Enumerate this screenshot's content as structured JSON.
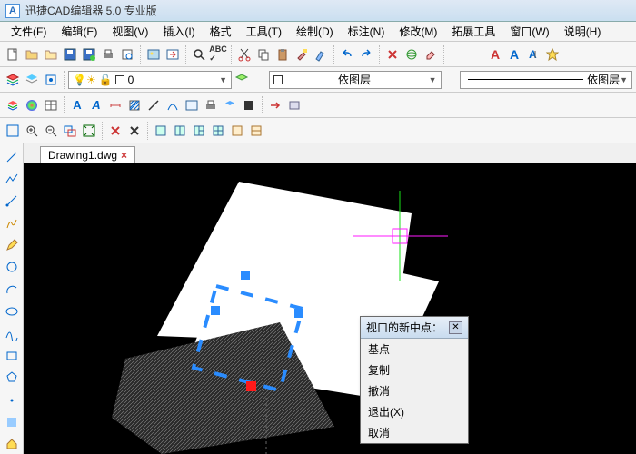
{
  "app": {
    "title": "迅捷CAD编辑器 5.0 专业版",
    "logo_text": "A"
  },
  "menu": {
    "items": [
      "文件(F)",
      "编辑(E)",
      "视图(V)",
      "插入(I)",
      "格式",
      "工具(T)",
      "绘制(D)",
      "标注(N)",
      "修改(M)",
      "拓展工具",
      "窗口(W)",
      "说明(H)"
    ]
  },
  "layer": {
    "current": "0",
    "bylayer1": "依图层",
    "bylayer2": "依图层"
  },
  "tab": {
    "name": "Drawing1.dwg"
  },
  "context": {
    "title": "视口的新中点：",
    "items": [
      "基点",
      "复制",
      "撤消",
      "退出(X)",
      "取消"
    ]
  },
  "letterA": "A"
}
